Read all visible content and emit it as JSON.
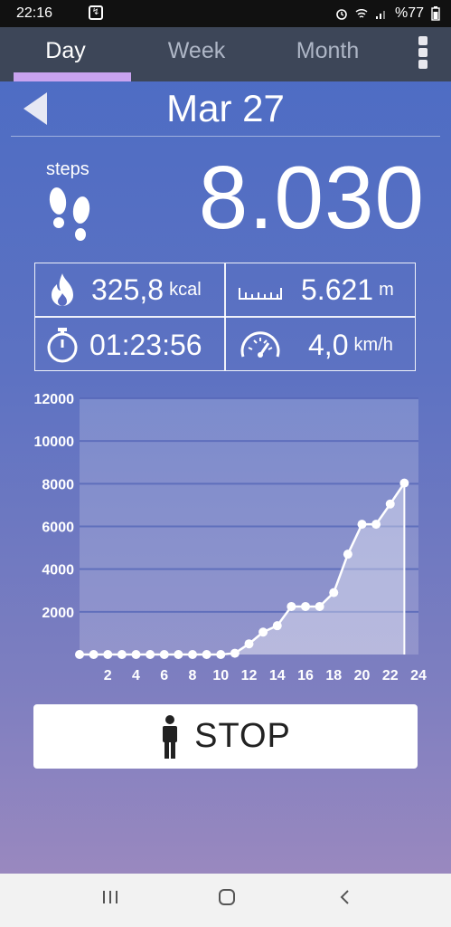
{
  "status_bar": {
    "time": "22:16",
    "battery": "%77"
  },
  "tabs": [
    {
      "label": "Day",
      "active": true
    },
    {
      "label": "Week",
      "active": false
    },
    {
      "label": "Month",
      "active": false
    }
  ],
  "header": {
    "date": "Mar 27"
  },
  "steps": {
    "label": "steps",
    "value": "8.030"
  },
  "stats": {
    "calories": {
      "value": "325,8",
      "unit": "kcal"
    },
    "distance": {
      "value": "5.621",
      "unit": "m"
    },
    "duration": {
      "value": "01:23:56"
    },
    "speed": {
      "value": "4,0",
      "unit": "km/h"
    }
  },
  "chart_data": {
    "type": "line",
    "title": "",
    "xlabel": "",
    "ylabel": "",
    "x": [
      0,
      1,
      2,
      3,
      4,
      5,
      6,
      7,
      8,
      9,
      10,
      11,
      12,
      13,
      14,
      15,
      16,
      17,
      18,
      19,
      20,
      21,
      22,
      23
    ],
    "values": [
      0,
      0,
      0,
      0,
      0,
      0,
      0,
      0,
      0,
      0,
      0,
      60,
      500,
      1050,
      1350,
      2250,
      2250,
      2250,
      2900,
      4700,
      6100,
      6100,
      7050,
      8030
    ],
    "x_ticks": [
      "2",
      "4",
      "6",
      "8",
      "10",
      "12",
      "14",
      "16",
      "18",
      "20",
      "22",
      "24"
    ],
    "y_ticks": [
      "2000",
      "4000",
      "6000",
      "8000",
      "10000",
      "12000"
    ],
    "xlim": [
      0,
      24
    ],
    "ylim": [
      0,
      12000
    ],
    "grid": true,
    "colors": {
      "line": "#ffffff",
      "fill": "#ffffff",
      "plot_bg": "#ffffff"
    }
  },
  "stop_button": {
    "label": "STOP"
  },
  "colors": {
    "tab_bar": "#3d4658",
    "tab_indicator": "#c9a3f0",
    "gradient_top": "#4a6bc4",
    "gradient_bottom": "#9988bf"
  }
}
